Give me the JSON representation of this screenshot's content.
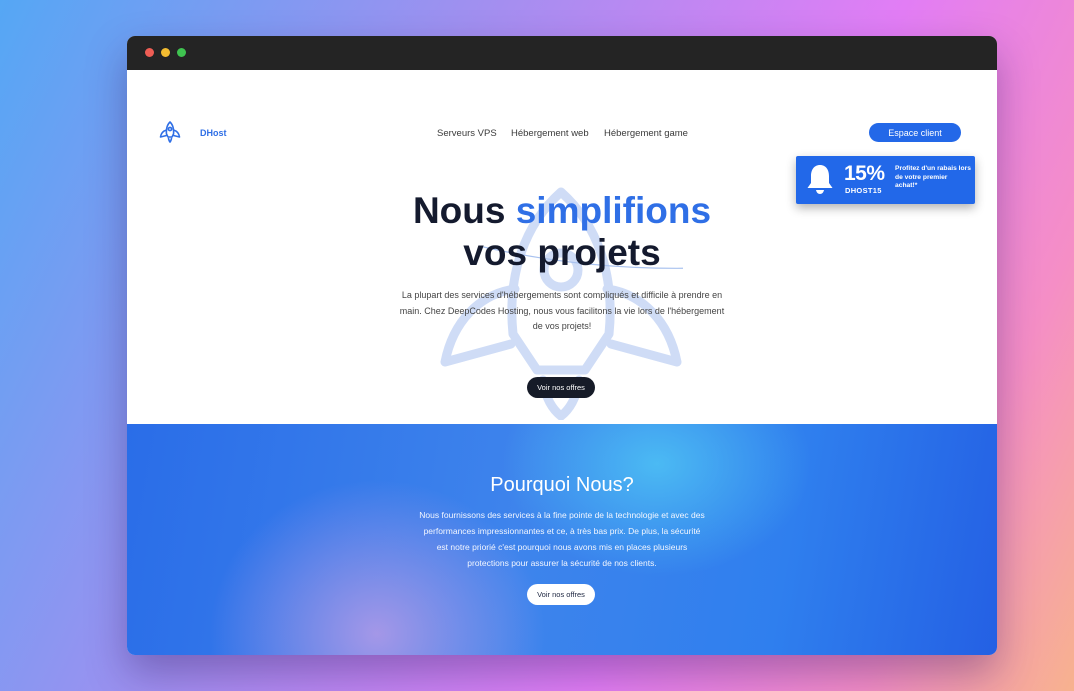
{
  "brand": {
    "name": "DHost",
    "logo_icon": "rocket-icon"
  },
  "nav": {
    "items": [
      "Serveurs VPS",
      "Hébergement web",
      "Hébergement game"
    ]
  },
  "header": {
    "client_button": "Espace client"
  },
  "promo": {
    "icon": "bell-icon",
    "percent": "15%",
    "code": "DHOST15",
    "description": "Profitez d'un rabais lors de votre premier achat!*"
  },
  "hero": {
    "title_part1": "Nous",
    "title_accent": "simplifions",
    "title_part2": "vos projets",
    "text": "La plupart des services d'hébergements sont compliqués et difficile à prendre en main. Chez DeepCodes Hosting, nous vous facilitons la vie lors de l'hébergement de vos projets!",
    "cta": "Voir nos offres"
  },
  "why": {
    "title": "Pourquoi Nous?",
    "text": "Nous fournissons des services à la fine pointe de la technologie et avec des performances impressionnantes et ce, à très bas prix. De plus, la sécurité est notre priorié c'est pourquoi nous avons mis en places plusieurs protections pour assurer la sécurité de nos clients.",
    "cta": "Voir nos offres"
  },
  "colors": {
    "accent": "#2f6fe6",
    "button_blue": "#2368e8",
    "dark": "#141a2e",
    "titlebar": "#242424"
  }
}
